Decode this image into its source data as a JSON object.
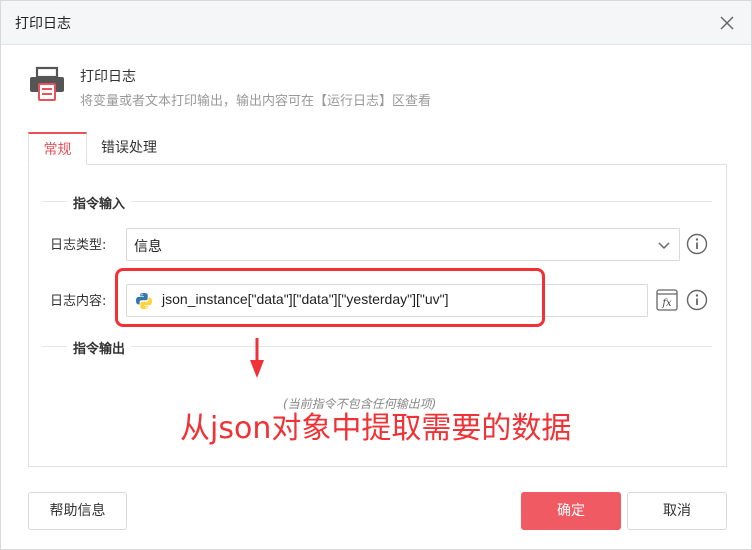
{
  "dialog": {
    "title": "打印日志"
  },
  "header": {
    "icon": "printer-icon",
    "title": "打印日志",
    "description": "将变量或者文本打印输出，输出内容可在【运行日志】区查看"
  },
  "tabs": [
    {
      "label": "常规",
      "active": true
    },
    {
      "label": "错误处理",
      "active": false
    }
  ],
  "input_section": {
    "title": "指令输入",
    "log_type": {
      "label": "日志类型:",
      "value": "信息"
    },
    "log_content": {
      "label": "日志内容:",
      "value": "json_instance[\"data\"][\"data\"][\"yesterday\"][\"uv\"]",
      "icon": "python-icon"
    }
  },
  "output_section": {
    "title": "指令输出",
    "empty_note": "(当前指令不包含任何输出项)"
  },
  "annotation": "从json对象中提取需要的数据",
  "buttons": {
    "help": "帮助信息",
    "ok": "确定",
    "cancel": "取消"
  },
  "colors": {
    "accent": "#e9515a",
    "annotation": "#f03236",
    "primary_button": "#f05a63"
  }
}
